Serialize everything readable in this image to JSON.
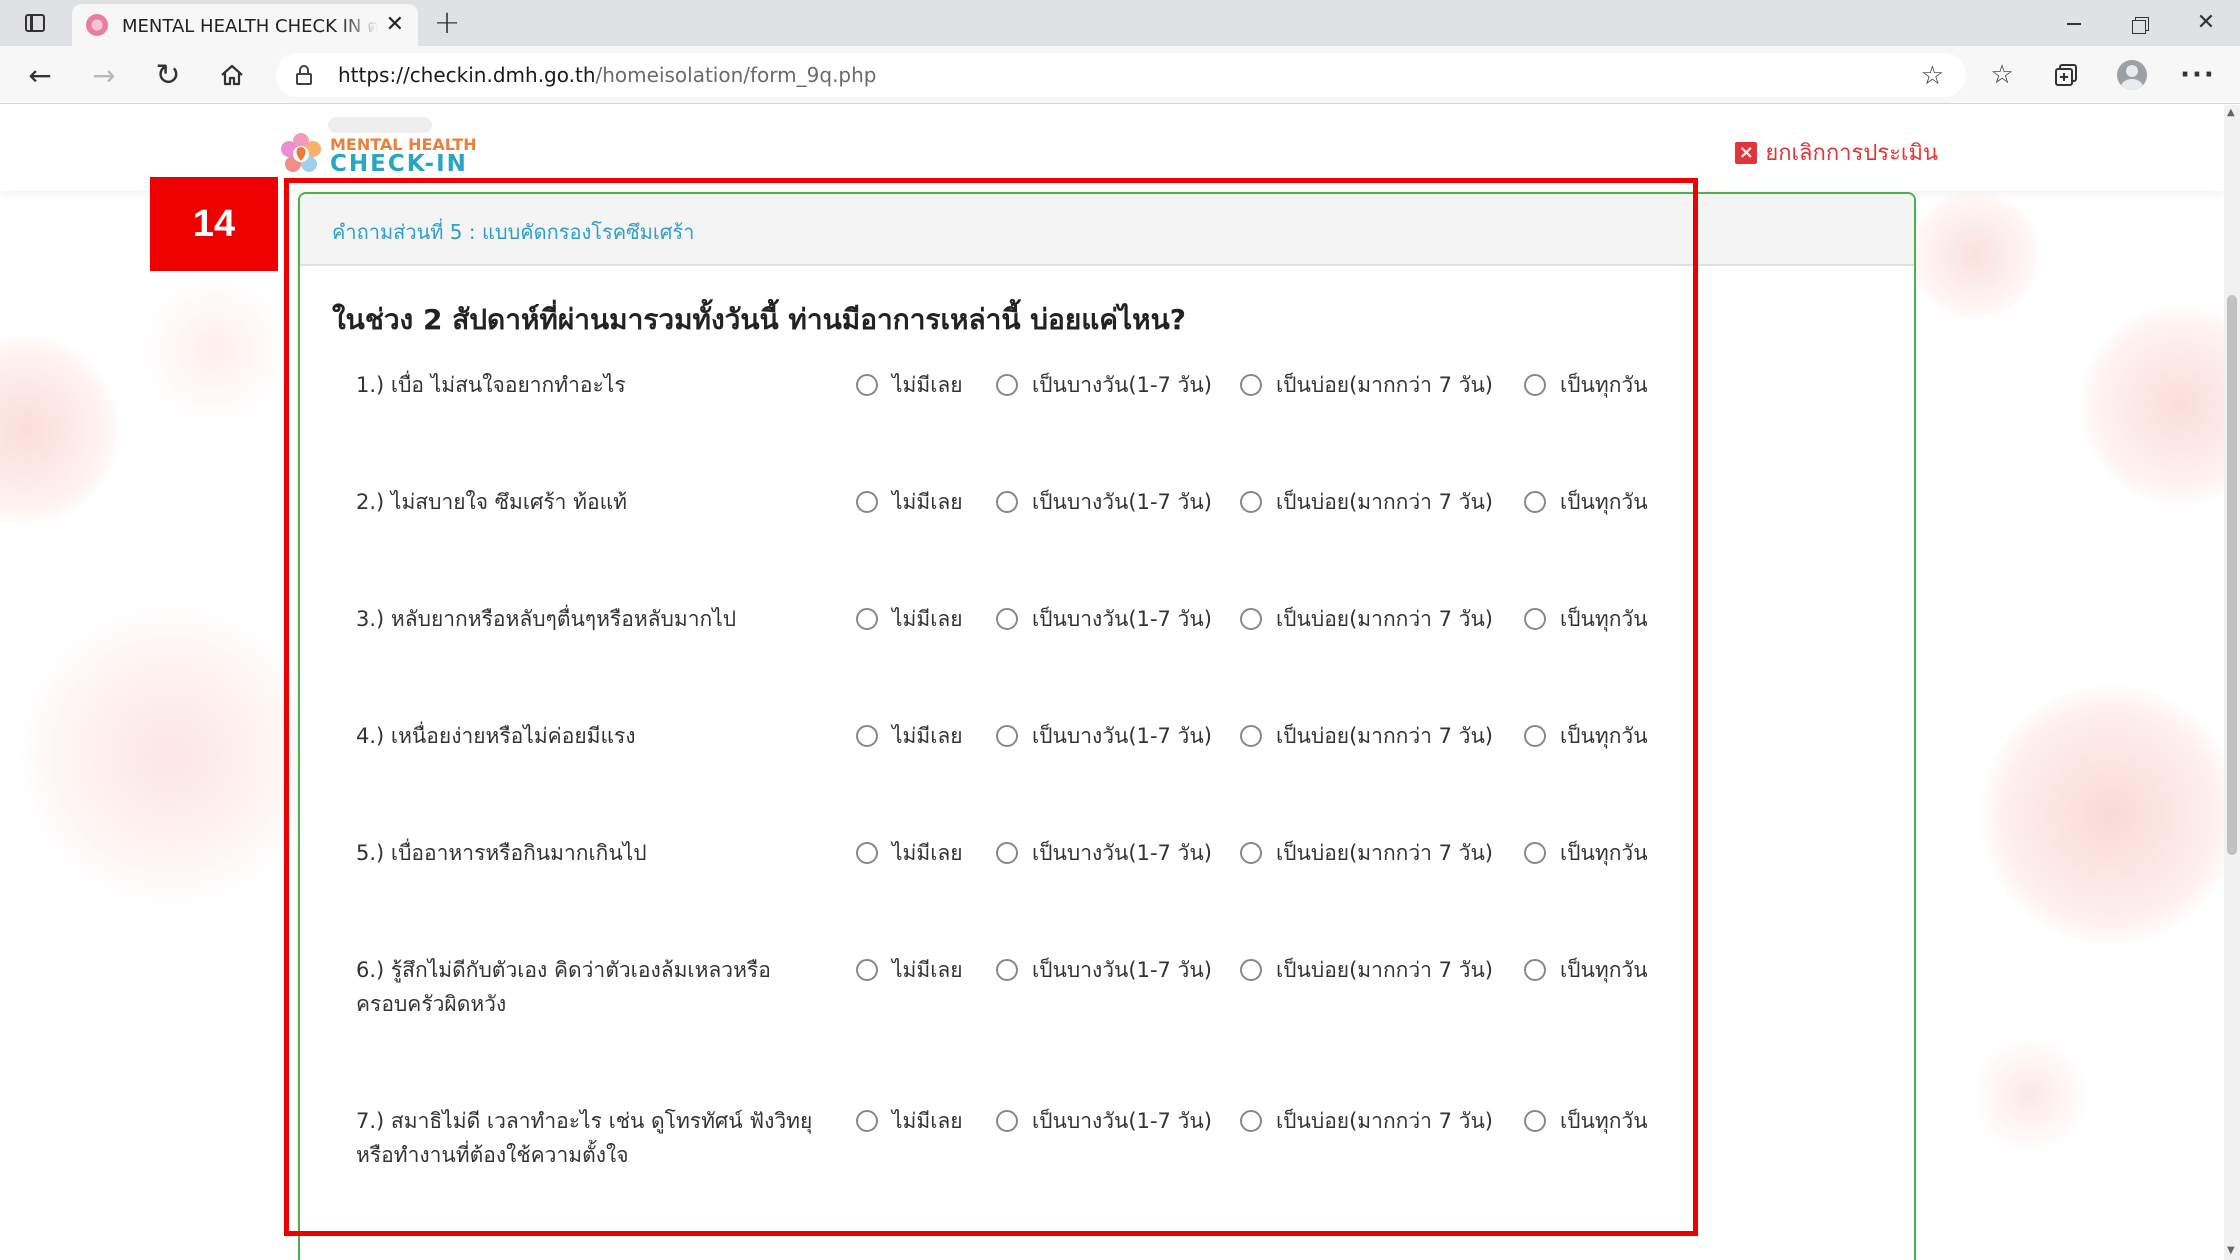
{
  "browser": {
    "tab_title": "MENTAL HEALTH CHECK IN ตรวจ",
    "new_tab_symbol": "+",
    "url_host": "https://checkin.dmh.go.th",
    "url_path": "/homeisolation/form_9q.php",
    "icons": {
      "tab_actions": "tab-actions-icon",
      "favicon": "flower-favicon",
      "close": "close-icon",
      "back": "back-arrow-icon",
      "forward": "forward-arrow-icon",
      "reload": "reload-icon",
      "home": "home-icon",
      "lock": "lock-icon",
      "add_favorite": "star-plus-icon",
      "favorites": "favorites-icon",
      "collections": "collections-icon",
      "profile": "profile-icon",
      "more": "more-icon"
    }
  },
  "site": {
    "logo_line1": "MENTAL HEALTH",
    "logo_line2": "CHECK-IN",
    "cancel_label": "ยกเลิกการประเมิน",
    "cancel_icon": "x-square-icon",
    "accent_color": "#4caf50",
    "title_color": "#2e9fc9",
    "cancel_color": "#e3343a"
  },
  "annotation": {
    "step_number": "14",
    "highlight_color": "#ee0000"
  },
  "form": {
    "section_title": "คำถามส่วนที่ 5 : แบบคัดกรองโรคซึมเศร้า",
    "heading": "ในช่วง 2 สัปดาห์ที่ผ่านมารวมทั้งวันนี้ ท่านมีอาการเหล่านี้ บ่อยแค่ไหน?",
    "options": [
      "ไม่มีเลย",
      "เป็นบางวัน(1-7 วัน)",
      "เป็นบ่อย(มากกว่า 7 วัน)",
      "เป็นทุกวัน"
    ],
    "questions": [
      "1.) เบื่อ ไม่สนใจอยากทำอะไร",
      "2.) ไม่สบายใจ ซึมเศร้า ท้อแท้",
      "3.) หลับยากหรือหลับๆตื่นๆหรือหลับมากไป",
      "4.) เหนื่อยง่ายหรือไม่ค่อยมีแรง",
      "5.) เบื่ออาหารหรือกินมากเกินไป",
      "6.) รู้สึกไม่ดีกับตัวเอง คิดว่าตัวเองล้มเหลวหรือครอบครัวผิดหวัง",
      "7.) สมาธิไม่ดี เวลาทำอะไร เช่น ดูโทรทัศน์ ฟังวิทยุ หรือทำงานที่ต้องใช้ความตั้งใจ"
    ]
  }
}
